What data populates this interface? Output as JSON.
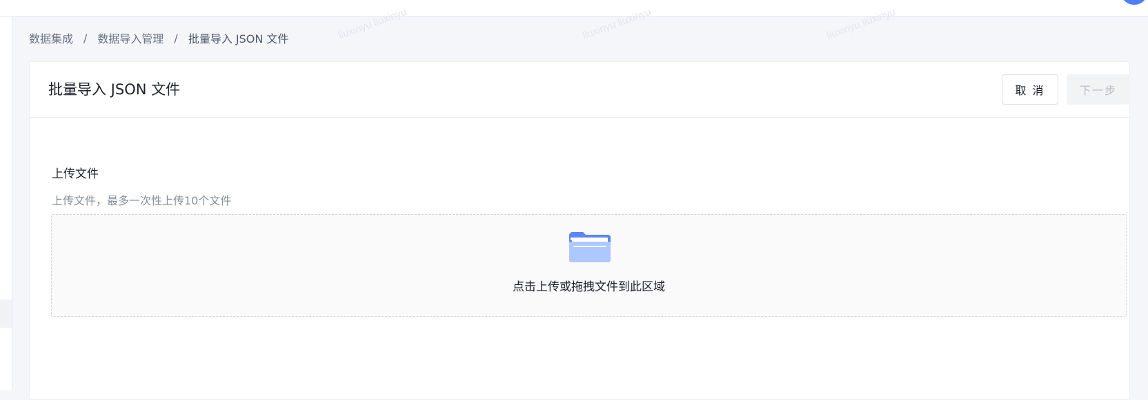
{
  "breadcrumb": {
    "items": [
      "数据集成",
      "数据导入管理",
      "批量导入 JSON 文件"
    ],
    "separator": "/"
  },
  "page": {
    "title": "批量导入 JSON 文件"
  },
  "actions": {
    "cancel_label": "取 消",
    "next_label": "下一步"
  },
  "upload": {
    "label": "上传文件",
    "hint": "上传文件，最多一次性上传10个文件",
    "dropzone_text": "点击上传或拖拽文件到此区域"
  },
  "watermark": {
    "text": "liuxinyu liuxinyu"
  },
  "colors": {
    "accent": "#4f7cf7",
    "folder_light": "#aec8ff",
    "folder_dark": "#5b86f3"
  }
}
